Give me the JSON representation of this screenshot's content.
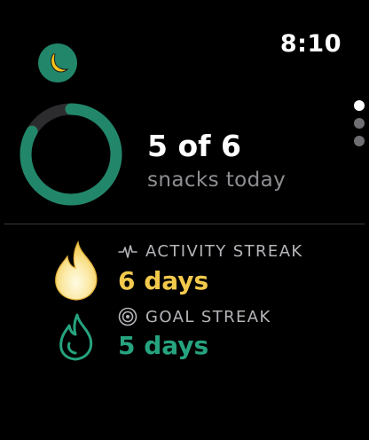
{
  "status": {
    "time": "8:10"
  },
  "app": {
    "icon": "banana-icon",
    "accent": "#22876a"
  },
  "pager": {
    "pages": 3,
    "current": 1
  },
  "progress": {
    "headline": "5 of 6",
    "caption": "snacks today",
    "completed": 5,
    "goal": 6,
    "ring_color": "#22876a",
    "track_color": "#2c2c2e"
  },
  "streaks": {
    "activity": {
      "label": "ACTIVITY STREAK",
      "value": "6 days",
      "icon": "flame-filled-icon",
      "label_icon": "activity-pulse-icon",
      "color": "#f2c94c"
    },
    "goal": {
      "label": "GOAL STREAK",
      "value": "5 days",
      "icon": "flame-outline-icon",
      "label_icon": "target-icon",
      "color": "#26a37f"
    }
  }
}
